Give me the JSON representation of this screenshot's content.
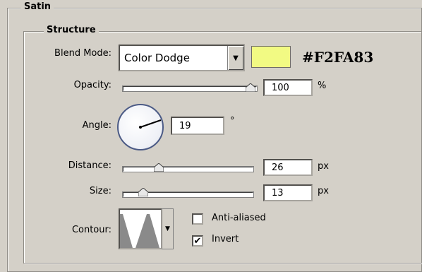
{
  "satin": {
    "title": "Satin",
    "structure": {
      "title": "Structure",
      "blend_mode": {
        "label": "Blend Mode:",
        "value": "Color Dodge",
        "color": "#F2FA83",
        "hex_label": "#F2FA83"
      },
      "opacity": {
        "label": "Opacity:",
        "value": "100",
        "unit": "%",
        "slider_fraction": 1.0
      },
      "angle": {
        "label": "Angle:",
        "value": "19",
        "unit": "°"
      },
      "distance": {
        "label": "Distance:",
        "value": "26",
        "unit": "px",
        "slider_fraction": 0.26
      },
      "size": {
        "label": "Size:",
        "value": "13",
        "unit": "px",
        "slider_fraction": 0.13
      },
      "contour": {
        "label": "Contour:"
      },
      "anti_aliased": {
        "label": "Anti-aliased",
        "checked": false
      },
      "invert": {
        "label": "Invert",
        "checked": true,
        "check_mark": "✔"
      }
    }
  }
}
